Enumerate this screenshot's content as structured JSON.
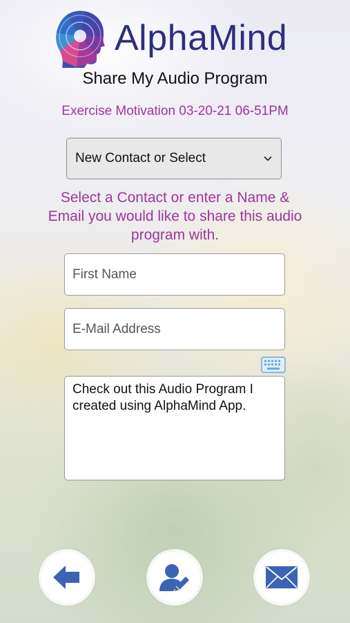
{
  "app": {
    "name": "AlphaMind"
  },
  "header": {
    "title": "Share My Audio Program"
  },
  "program": {
    "label": "Exercise Motivation 03-20-21 06-51PM"
  },
  "contact_select": {
    "selected": "New Contact or Select"
  },
  "instructions": "Select a Contact or enter a Name & Email you would like to share this audio program with.",
  "form": {
    "first_name_placeholder": "First Name",
    "email_placeholder": "E-Mail Address",
    "message": "Check out this Audio Program I created using AlphaMind App."
  },
  "icons": {
    "logo": "head-spiral-logo",
    "dropdown": "chevron-down-icon",
    "keyboard": "keyboard-icon",
    "back": "arrow-left-icon",
    "contacts": "person-edit-icon",
    "send": "envelope-icon"
  },
  "colors": {
    "brand": "#2c2f7d",
    "accent_text": "#a0359a",
    "icon_blue": "#3d63b4"
  }
}
